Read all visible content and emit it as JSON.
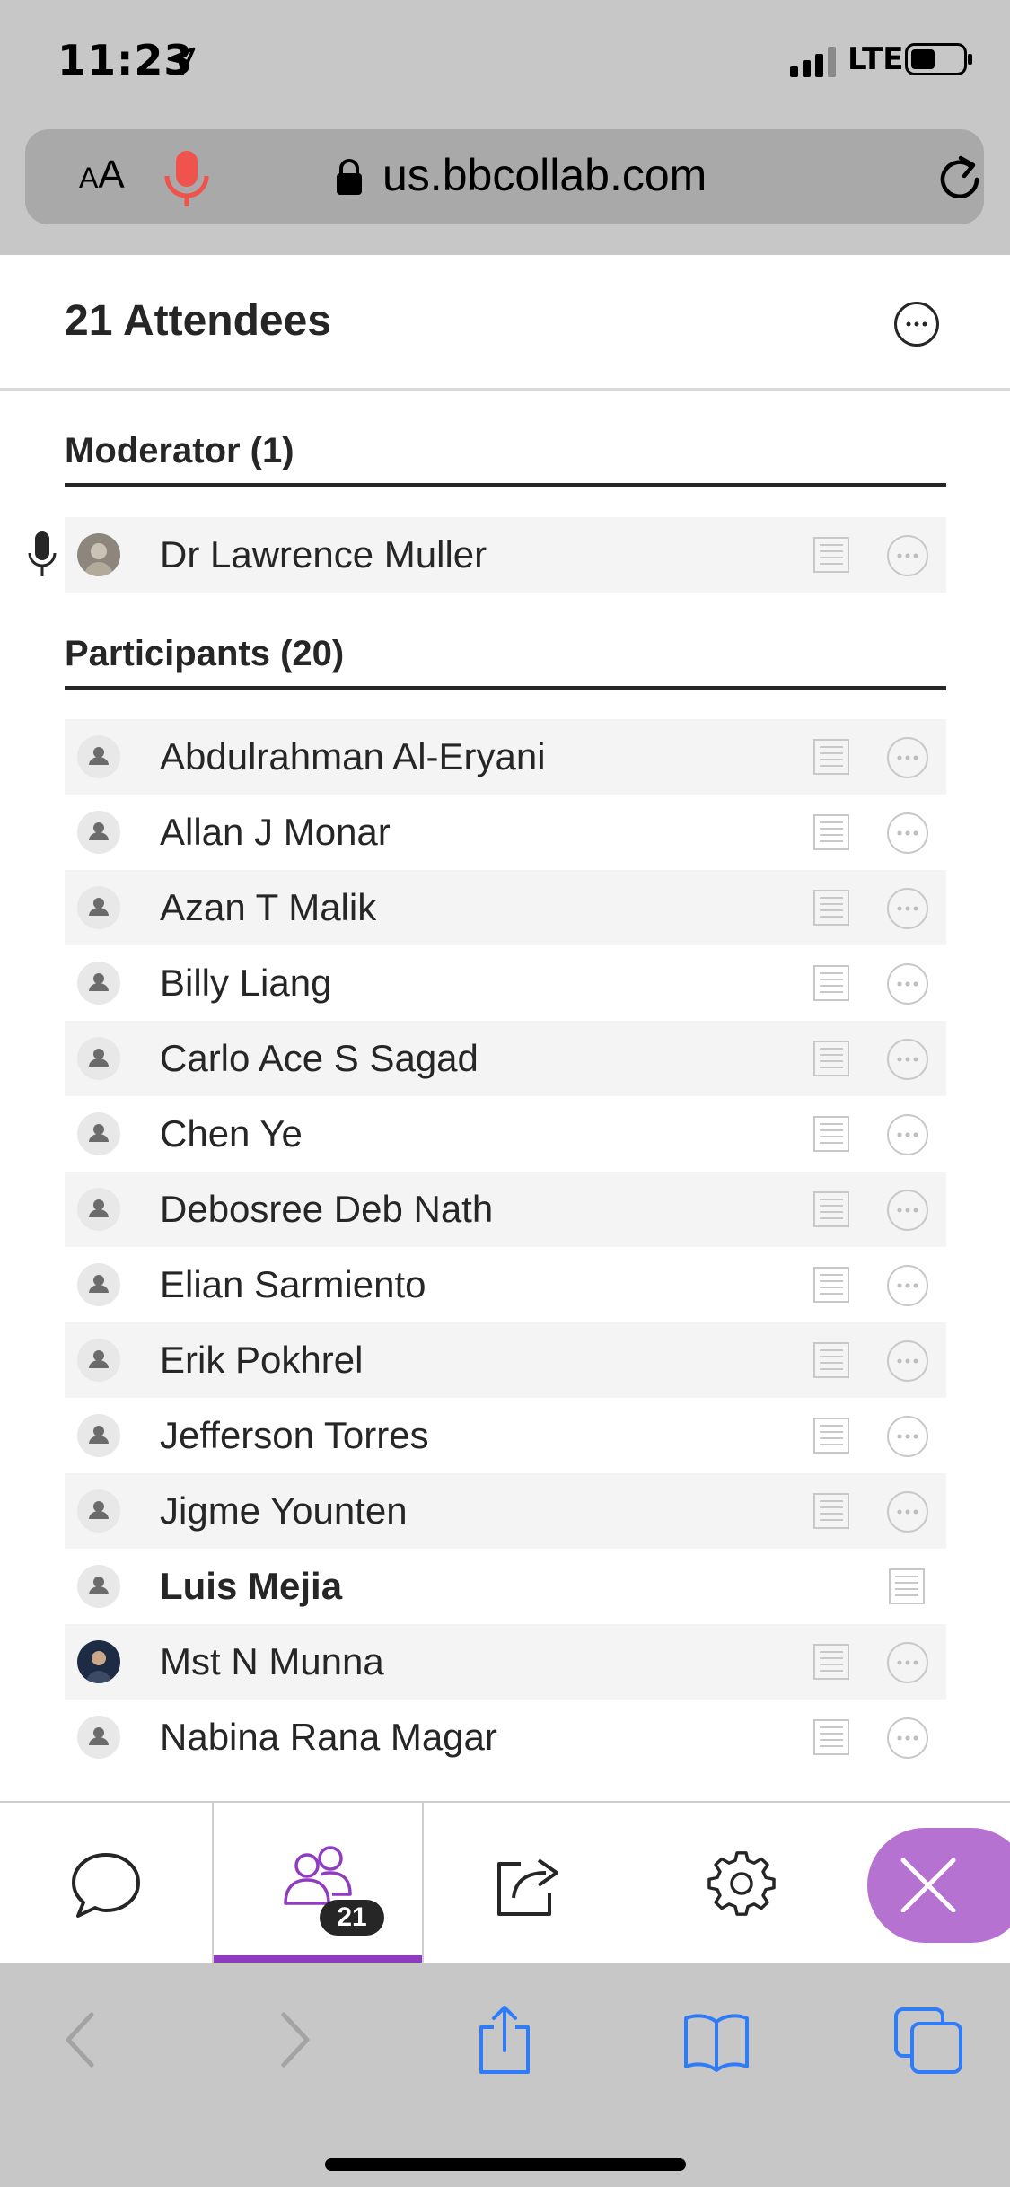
{
  "status_bar": {
    "time": "11:23",
    "network": "LTE"
  },
  "address_bar": {
    "text_size_label": "AA",
    "url": "us.bbcollab.com"
  },
  "panel": {
    "title": "21 Attendees",
    "moderator_heading": "Moderator (1)",
    "participants_heading": "Participants (20)",
    "moderator": {
      "name": "Dr Lawrence Muller",
      "avatar": "photo"
    },
    "participants": [
      {
        "name": "Abdulrahman Al-Eryani",
        "avatar": "default"
      },
      {
        "name": "Allan J Monar",
        "avatar": "default"
      },
      {
        "name": "Azan T Malik",
        "avatar": "default"
      },
      {
        "name": "Billy Liang",
        "avatar": "default"
      },
      {
        "name": "Carlo Ace S Sagad",
        "avatar": "default"
      },
      {
        "name": "Chen Ye",
        "avatar": "default"
      },
      {
        "name": "Debosree Deb Nath",
        "avatar": "default"
      },
      {
        "name": "Elian Sarmiento",
        "avatar": "default"
      },
      {
        "name": "Erik Pokhrel",
        "avatar": "default"
      },
      {
        "name": "Jefferson Torres",
        "avatar": "default"
      },
      {
        "name": "Jigme Younten",
        "avatar": "default"
      },
      {
        "name": "Luis Mejia",
        "avatar": "default",
        "is_self": true
      },
      {
        "name": "Mst N Munna",
        "avatar": "photo"
      },
      {
        "name": "Nabina Rana Magar",
        "avatar": "default"
      }
    ]
  },
  "tab_bar": {
    "tabs": [
      {
        "name": "chat",
        "icon": "chat-bubble-icon"
      },
      {
        "name": "attendees",
        "icon": "attendees-icon",
        "badge": "21",
        "active": true
      },
      {
        "name": "share-content",
        "icon": "share-icon"
      },
      {
        "name": "settings",
        "icon": "gear-icon"
      }
    ],
    "close_icon": "close-icon",
    "accent_color": "#8f3cc0"
  },
  "safari_toolbar": {
    "icons": [
      "back-icon",
      "forward-icon",
      "share-icon",
      "bookmarks-icon",
      "tabs-icon"
    ],
    "accent_color": "#2f7cf6"
  }
}
